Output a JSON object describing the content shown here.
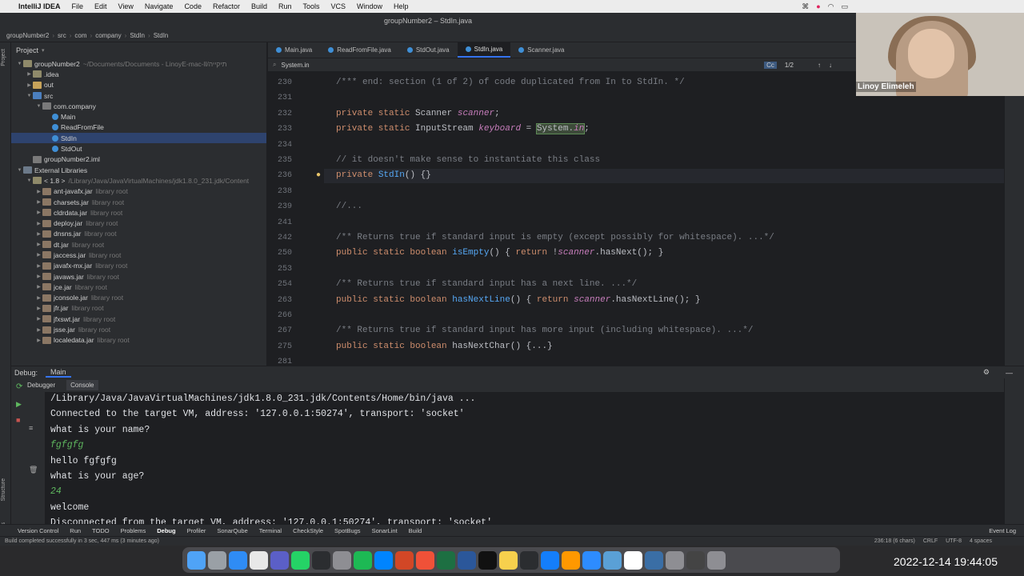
{
  "menubar": {
    "app": "IntelliJ IDEA",
    "items": [
      "File",
      "Edit",
      "View",
      "Navigate",
      "Code",
      "Refactor",
      "Build",
      "Run",
      "Tools",
      "VCS",
      "Window",
      "Help"
    ]
  },
  "window_title": "groupNumber2 – StdIn.java",
  "breadcrumb": [
    "groupNumber2",
    "src",
    "com",
    "company",
    "StdIn",
    "StdIn"
  ],
  "project_panel": {
    "title": "Project",
    "tree": [
      {
        "label": "groupNumber2",
        "dim": "~/Documents/Documents - LinoyE-mac-ll/תיקייה",
        "indent": 0,
        "icon": "folder",
        "arrow": "▼"
      },
      {
        "label": ".idea",
        "dim": "",
        "indent": 1,
        "icon": "folder",
        "arrow": "▶"
      },
      {
        "label": "out",
        "dim": "",
        "indent": 1,
        "icon": "out",
        "arrow": "▶"
      },
      {
        "label": "src",
        "dim": "",
        "indent": 1,
        "icon": "src",
        "arrow": "▼"
      },
      {
        "label": "com.company",
        "dim": "",
        "indent": 2,
        "icon": "pkg",
        "arrow": "▼"
      },
      {
        "label": "Main",
        "dim": "",
        "indent": 3,
        "icon": "cls",
        "arrow": ""
      },
      {
        "label": "ReadFromFile",
        "dim": "",
        "indent": 3,
        "icon": "cls",
        "arrow": ""
      },
      {
        "label": "StdIn",
        "dim": "",
        "indent": 3,
        "icon": "cls",
        "arrow": "",
        "selected": true
      },
      {
        "label": "StdOut",
        "dim": "",
        "indent": 3,
        "icon": "cls",
        "arrow": ""
      },
      {
        "label": "groupNumber2.iml",
        "dim": "",
        "indent": 1,
        "icon": "pkg",
        "arrow": ""
      },
      {
        "label": "External Libraries",
        "dim": "",
        "indent": 0,
        "icon": "lib",
        "arrow": "▼"
      },
      {
        "label": "< 1.8 >",
        "dim": "/Library/Java/JavaVirtualMachines/jdk1.8.0_231.jdk/Content",
        "indent": 1,
        "icon": "folder",
        "arrow": "▼"
      },
      {
        "label": "ant-javafx.jar",
        "dim": "library root",
        "indent": 2,
        "icon": "jar",
        "arrow": "▶"
      },
      {
        "label": "charsets.jar",
        "dim": "library root",
        "indent": 2,
        "icon": "jar",
        "arrow": "▶"
      },
      {
        "label": "cldrdata.jar",
        "dim": "library root",
        "indent": 2,
        "icon": "jar",
        "arrow": "▶"
      },
      {
        "label": "deploy.jar",
        "dim": "library root",
        "indent": 2,
        "icon": "jar",
        "arrow": "▶"
      },
      {
        "label": "dnsns.jar",
        "dim": "library root",
        "indent": 2,
        "icon": "jar",
        "arrow": "▶"
      },
      {
        "label": "dt.jar",
        "dim": "library root",
        "indent": 2,
        "icon": "jar",
        "arrow": "▶"
      },
      {
        "label": "jaccess.jar",
        "dim": "library root",
        "indent": 2,
        "icon": "jar",
        "arrow": "▶"
      },
      {
        "label": "javafx-mx.jar",
        "dim": "library root",
        "indent": 2,
        "icon": "jar",
        "arrow": "▶"
      },
      {
        "label": "javaws.jar",
        "dim": "library root",
        "indent": 2,
        "icon": "jar",
        "arrow": "▶"
      },
      {
        "label": "jce.jar",
        "dim": "library root",
        "indent": 2,
        "icon": "jar",
        "arrow": "▶"
      },
      {
        "label": "jconsole.jar",
        "dim": "library root",
        "indent": 2,
        "icon": "jar",
        "arrow": "▶"
      },
      {
        "label": "jfr.jar",
        "dim": "library root",
        "indent": 2,
        "icon": "jar",
        "arrow": "▶"
      },
      {
        "label": "jfxswt.jar",
        "dim": "library root",
        "indent": 2,
        "icon": "jar",
        "arrow": "▶"
      },
      {
        "label": "jsse.jar",
        "dim": "library root",
        "indent": 2,
        "icon": "jar",
        "arrow": "▶"
      },
      {
        "label": "localedata.jar",
        "dim": "library root",
        "indent": 2,
        "icon": "jar",
        "arrow": "▶"
      }
    ]
  },
  "editor_tabs": [
    {
      "label": "Main.java",
      "active": false
    },
    {
      "label": "ReadFromFile.java",
      "active": false
    },
    {
      "label": "StdOut.java",
      "active": false
    },
    {
      "label": "StdIn.java",
      "active": true
    },
    {
      "label": "Scanner.java",
      "active": false
    }
  ],
  "find": {
    "query": "System.in",
    "matches": "1/2"
  },
  "code": [
    {
      "ln": "230",
      "html": "<span class='cm'>/*** end: section (1 of 2) of code duplicated from In to StdIn. */</span>"
    },
    {
      "ln": "231",
      "html": ""
    },
    {
      "ln": "232",
      "html": "<span class='kw'>private static</span> Scanner <span class='fld'>scanner</span>;"
    },
    {
      "ln": "233",
      "html": "<span class='kw'>private static</span> InputStream <span class='fld'>keyboard</span> = <span class='mk'>System.<span class='fld'>in</span></span>;"
    },
    {
      "ln": "234",
      "html": ""
    },
    {
      "ln": "235",
      "html": "<span class='cm'>// it doesn't make sense to instantiate this class</span>"
    },
    {
      "ln": "236",
      "html": "<span class='kw'>private</span> <span class='fn'>StdIn</span>() {}"
    },
    {
      "ln": "238",
      "html": ""
    },
    {
      "ln": "239",
      "html": "<span class='cm'>//...</span>"
    },
    {
      "ln": "241",
      "html": ""
    },
    {
      "ln": "242",
      "html": "<span class='cm'>/** Returns true if standard input is empty (except possibly for whitespace). ...*/</span>"
    },
    {
      "ln": "250",
      "html": "<span class='kw'>public static boolean</span> <span class='fn'>isEmpty</span>() { <span class='kw'>return</span> !<span class='fld'>scanner</span>.hasNext(); }"
    },
    {
      "ln": "253",
      "html": ""
    },
    {
      "ln": "254",
      "html": "<span class='cm'>/** Returns true if standard input has a next line. ...*/</span>"
    },
    {
      "ln": "263",
      "html": "<span class='kw'>public static boolean</span> <span class='fn'>hasNextLine</span>() { <span class='kw'>return</span> <span class='fld'>scanner</span>.hasNextLine(); }"
    },
    {
      "ln": "266",
      "html": ""
    },
    {
      "ln": "267",
      "html": "<span class='cm'>/** Returns true if standard input has more input (including whitespace). ...*/</span>"
    },
    {
      "ln": "275",
      "html": "<span class='kw'>public static boolean</span> hasNextChar() {...}"
    },
    {
      "ln": "281",
      "html": ""
    }
  ],
  "debug": {
    "label": "Debug:",
    "config": "Main",
    "tabs": [
      "Debugger",
      "Console"
    ]
  },
  "console_lines": [
    {
      "text": "/Library/Java/JavaVirtualMachines/jdk1.8.0_231.jdk/Contents/Home/bin/java ...",
      "input": false
    },
    {
      "text": "Connected to the target VM, address: '127.0.0.1:50274', transport: 'socket'",
      "input": false
    },
    {
      "text": "what is your name?",
      "input": false
    },
    {
      "text": "fgfgfg",
      "input": true
    },
    {
      "text": "hello fgfgfg",
      "input": false
    },
    {
      "text": "what is your age?",
      "input": false
    },
    {
      "text": "24",
      "input": true
    },
    {
      "text": "welcome",
      "input": false
    },
    {
      "text": "Disconnected from the target VM, address: '127.0.0.1:50274', transport: 'socket'",
      "input": false
    }
  ],
  "toolwindows": [
    "Version Control",
    "Run",
    "TODO",
    "Problems",
    "Debug",
    "Profiler",
    "SonarQube",
    "Terminal",
    "CheckStyle",
    "SpotBugs",
    "SonarLint",
    "Build"
  ],
  "event_log": "Event Log",
  "status": {
    "message": "Build completed successfully in 3 sec, 447 ms (3 minutes ago)",
    "position": "236:18 (6 chars)",
    "line_sep": "CRLF",
    "encoding": "UTF-8",
    "indent": "4 spaces"
  },
  "webcam_name": "Linoy Elimeleh",
  "clock": "2022-12-14  19:44:05",
  "dock_icons": [
    "Finder",
    "Launchpad",
    "App Store",
    "Chrome",
    "Teams",
    "WhatsApp",
    "IntelliJ",
    "Help",
    "Spotify",
    "Messenger",
    "PowerPoint",
    "Swift",
    "Excel",
    "Word",
    "Terminal",
    "Notes",
    "Activity",
    "Xcode",
    "Sublime",
    "Zoom",
    "Preview",
    "Calendar",
    "Display",
    "Settings",
    "Screen",
    "Trash"
  ]
}
